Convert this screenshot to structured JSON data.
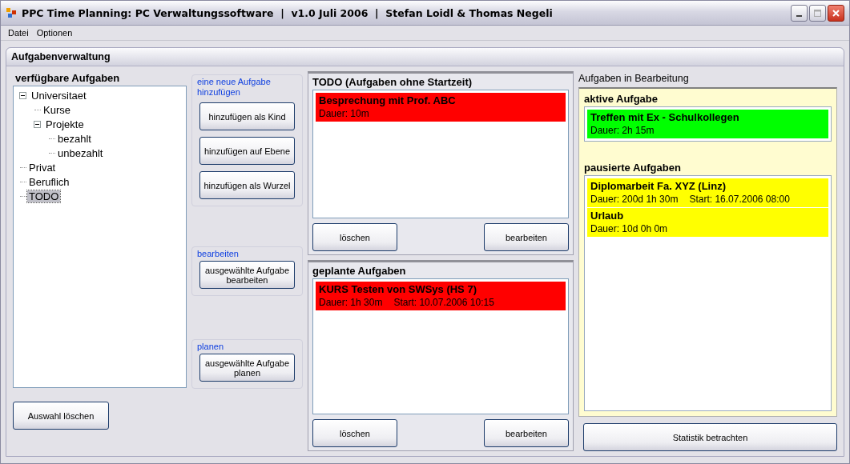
{
  "window": {
    "title": "PPC Time Planning: PC Verwaltungssoftware  |  v1.0 Juli 2006  |  Stefan Loidl & Thomas Negeli"
  },
  "menu": [
    {
      "label": "Datei"
    },
    {
      "label": "Optionen"
    }
  ],
  "group_title": "Aufgabenverwaltung",
  "available": {
    "title": "verfügbare Aufgaben",
    "tree": [
      {
        "label": "Universitaet",
        "selected": false,
        "expanded": true,
        "children": [
          {
            "label": "Kurse",
            "selected": false
          },
          {
            "label": "Projekte",
            "selected": false,
            "expanded": true,
            "children": [
              {
                "label": "bezahlt",
                "selected": false
              },
              {
                "label": "unbezahlt",
                "selected": false
              }
            ]
          }
        ]
      },
      {
        "label": "Privat",
        "selected": false
      },
      {
        "label": "Beruflich",
        "selected": false
      },
      {
        "label": "TODO",
        "selected": true
      }
    ],
    "clear_button": "Auswahl löschen"
  },
  "actions": [
    {
      "legend": "eine neue Aufgabe hinzufügen",
      "buttons": [
        "hinzufügen als Kind",
        "hinzufügen auf Ebene",
        "hinzufügen als Wurzel"
      ]
    },
    {
      "legend": "bearbeiten",
      "buttons": [
        "ausgewählte Aufgabe bearbeiten"
      ]
    },
    {
      "legend": "planen",
      "buttons": [
        "ausgewählte Aufgabe planen"
      ]
    }
  ],
  "todo": {
    "title": "TODO (Aufgaben ohne Startzeit)",
    "tasks": [
      {
        "name": "Besprechung mit Prof. ABC",
        "duration": "Dauer: 10m",
        "color": "#ff0000"
      }
    ],
    "buttons": [
      "löschen",
      "bearbeiten"
    ]
  },
  "planned": {
    "title": "geplante Aufgaben",
    "tasks": [
      {
        "name": "KURS Testen von SWSys (HS 7)",
        "duration": "Dauer: 1h 30m",
        "start": "Start: 10.07.2006 10:15",
        "color": "#ff0000"
      }
    ],
    "buttons": [
      "löschen",
      "bearbeiten"
    ]
  },
  "in_progress": {
    "title": "Aufgaben in Bearbeitung",
    "active_title": "aktive Aufgabe",
    "active": [
      {
        "name": "Treffen mit Ex - Schulkollegen",
        "duration": "Dauer: 2h 15m",
        "color": "#00ff00"
      }
    ],
    "paused_title": "pausierte Aufgaben",
    "paused": [
      {
        "name": "Diplomarbeit Fa. XYZ (Linz)",
        "duration": "Dauer: 200d 1h 30m",
        "start": "Start: 16.07.2006 08:00",
        "color": "#ffff00"
      },
      {
        "name": "Urlaub",
        "duration": "Dauer: 10d 0h 0m",
        "color": "#ffff00"
      }
    ],
    "button": "Statistik betrachten"
  }
}
